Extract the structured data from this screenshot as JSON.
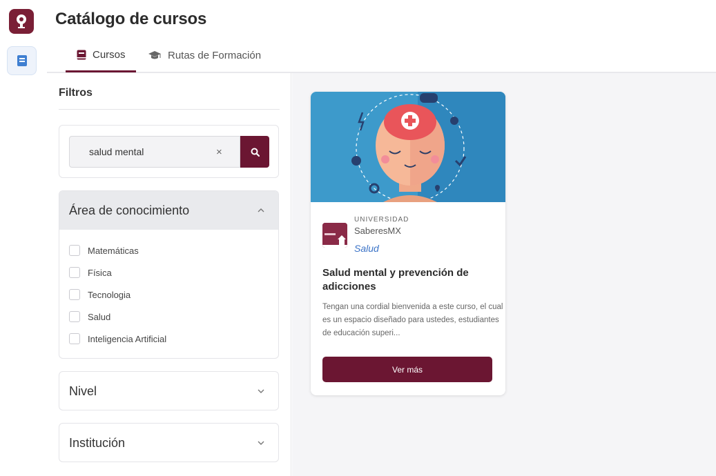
{
  "page": {
    "title": "Catálogo de cursos"
  },
  "tabs": [
    {
      "label": "Cursos",
      "icon": "book-icon",
      "active": true
    },
    {
      "label": "Rutas de Formación",
      "icon": "graduation-cap-icon",
      "active": false
    }
  ],
  "filters": {
    "title": "Filtros",
    "search": {
      "value": "salud mental",
      "clear_label": "×"
    },
    "sections": [
      {
        "title": "Área de conocimiento",
        "expanded": true,
        "options": [
          "Matemáticas",
          "Física",
          "Tecnologia",
          "Salud",
          "Inteligencia Artificial"
        ]
      },
      {
        "title": "Nivel",
        "expanded": false
      },
      {
        "title": "Institución",
        "expanded": false
      }
    ]
  },
  "results": [
    {
      "institution_type": "UNIVERSIDAD",
      "institution_name": "SaberesMX",
      "area": "Salud",
      "title": "Salud mental y prevención de adicciones",
      "description": "Tengan una cordial bienvenida a este curso, el cual es un espacio diseñado para ustedes, estudiantes de educación superi...",
      "button_label": "Ver más"
    }
  ],
  "colors": {
    "brand": "#6b1632",
    "link": "#3b73c7",
    "illustration_bg": "#3d9acb"
  }
}
